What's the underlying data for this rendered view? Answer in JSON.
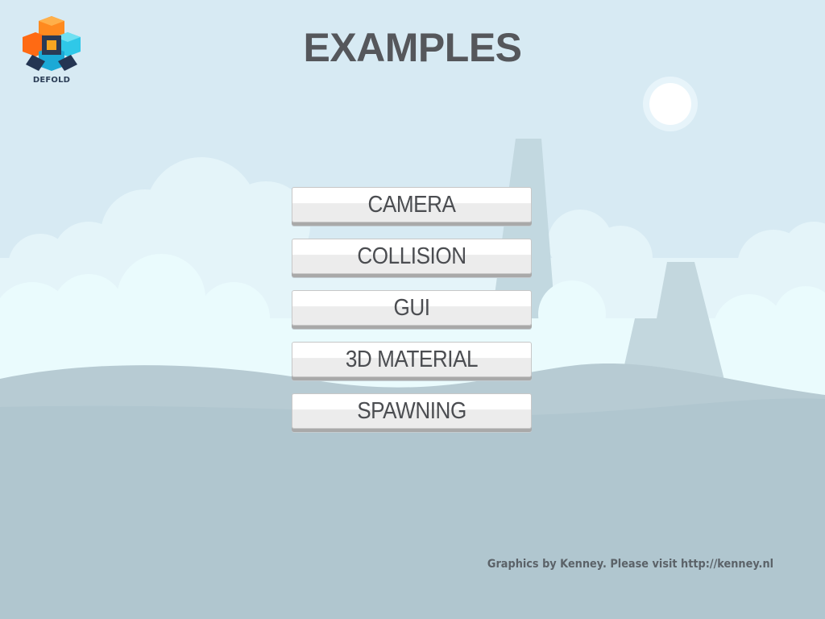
{
  "logo": {
    "text": "DEFOLD",
    "icon": "defold-logo-icon"
  },
  "title": "EXAMPLES",
  "menu": {
    "items": [
      {
        "label": "CAMERA"
      },
      {
        "label": "COLLISION"
      },
      {
        "label": "GUI"
      },
      {
        "label": "3D MATERIAL"
      },
      {
        "label": "SPAWNING"
      }
    ]
  },
  "credits": "Graphics by Kenney. Please visit http://kenney.nl",
  "colors": {
    "sky": "#d7eaf3",
    "cloud": "#e9f8fb",
    "ground": "#b0c6cf",
    "title": "#55575b",
    "button_text": "#4b4d51"
  }
}
